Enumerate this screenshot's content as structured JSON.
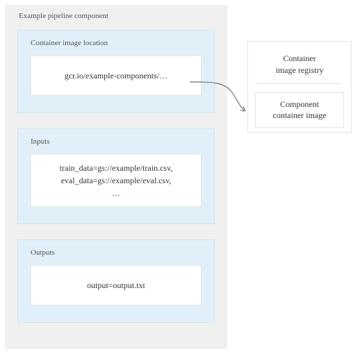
{
  "panel": {
    "title": "Example pipeline component",
    "sections": [
      {
        "title": "Container image location",
        "lines": [
          "gcr.io/example-components/…"
        ]
      },
      {
        "title": "Inputs",
        "lines": [
          "train_data=gs://example/train.csv,",
          "eval_data=gs://example/eval.csv,",
          "…"
        ]
      },
      {
        "title": "Outputs",
        "lines": [
          "output=output.txt"
        ]
      }
    ]
  },
  "registry": {
    "title_line1": "Container",
    "title_line2": "image registry",
    "inner_line1": "Component",
    "inner_line2": "container image"
  }
}
